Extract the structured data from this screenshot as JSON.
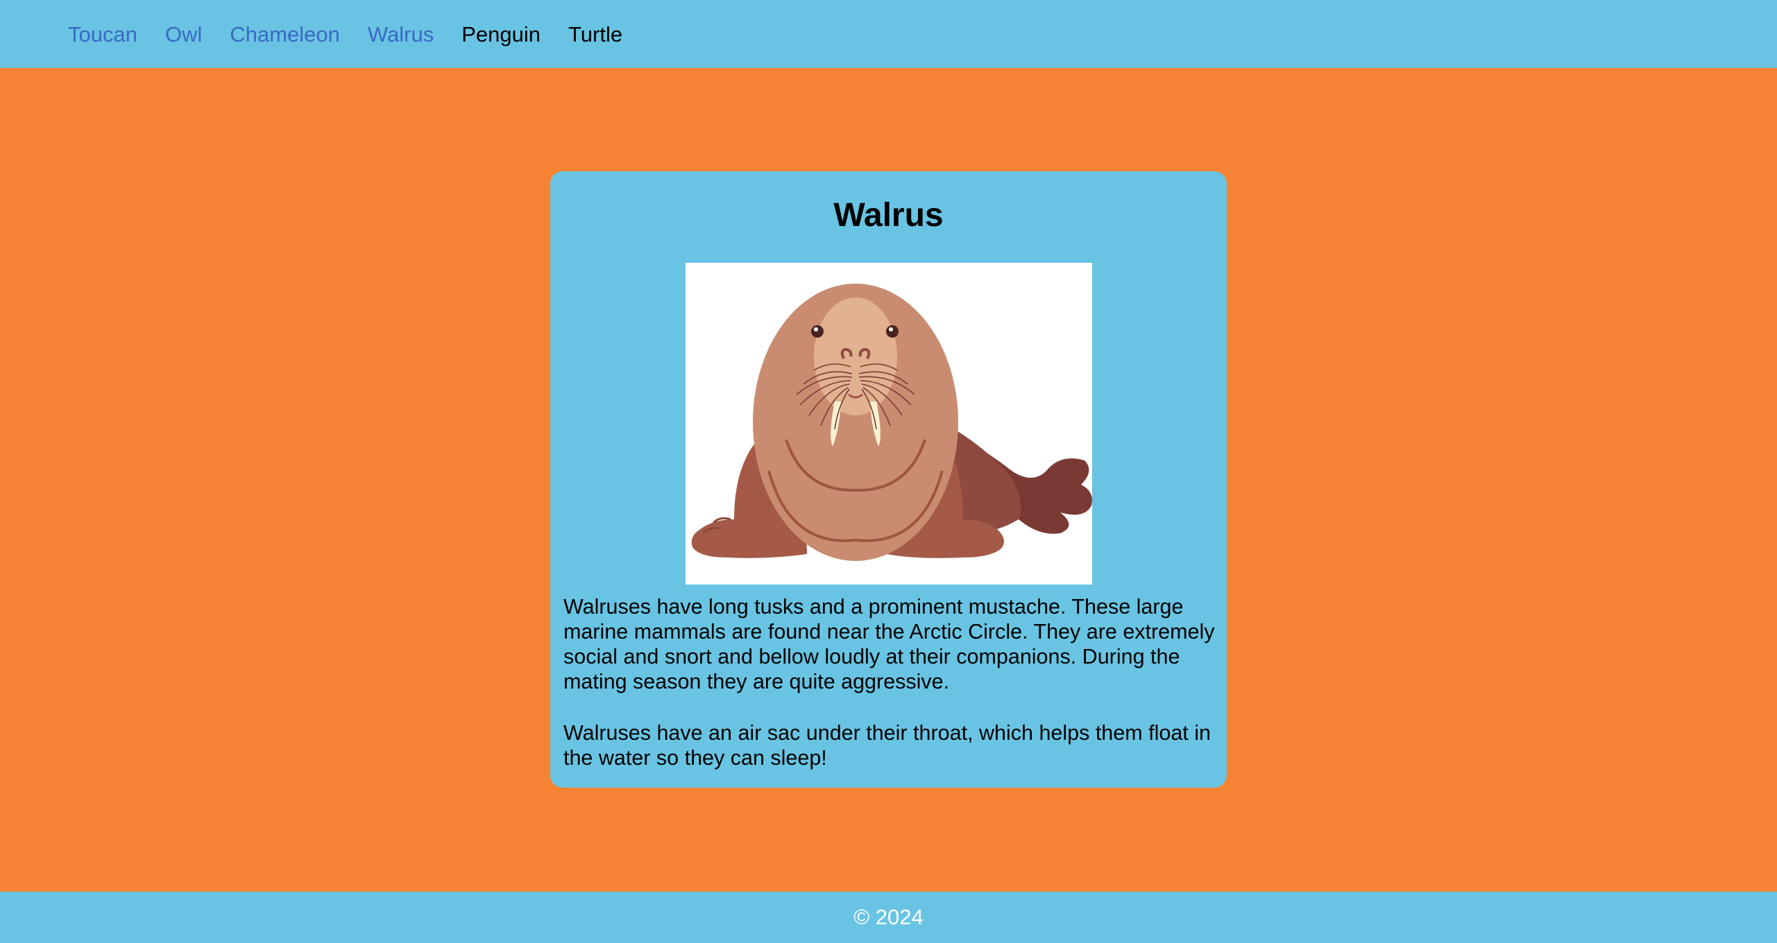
{
  "nav": {
    "items": [
      {
        "label": "Toucan",
        "state": "visited"
      },
      {
        "label": "Owl",
        "state": "visited"
      },
      {
        "label": "Chameleon",
        "state": "visited"
      },
      {
        "label": "Walrus",
        "state": "visited"
      },
      {
        "label": "Penguin",
        "state": "unvisited"
      },
      {
        "label": "Turtle",
        "state": "unvisited"
      }
    ]
  },
  "card": {
    "title": "Walrus",
    "image": {
      "icon": "walrus-illustration"
    },
    "paragraphs": [
      "Walruses have long tusks and a prominent mustache. These large marine mammals are found near the Arctic Circle. They are extremely social and snort and bellow loudly at their companions. During the mating season they are quite aggressive.",
      "Walruses have an air sac under their throat, which helps them float in the water so they can sleep!"
    ]
  },
  "footer": {
    "text": "© 2024"
  },
  "colors": {
    "page_background": "#f68333",
    "panel_background": "#69c4e3",
    "visited_link": "#3a68c4",
    "link": "#000000",
    "footer_text": "#ffffff"
  }
}
